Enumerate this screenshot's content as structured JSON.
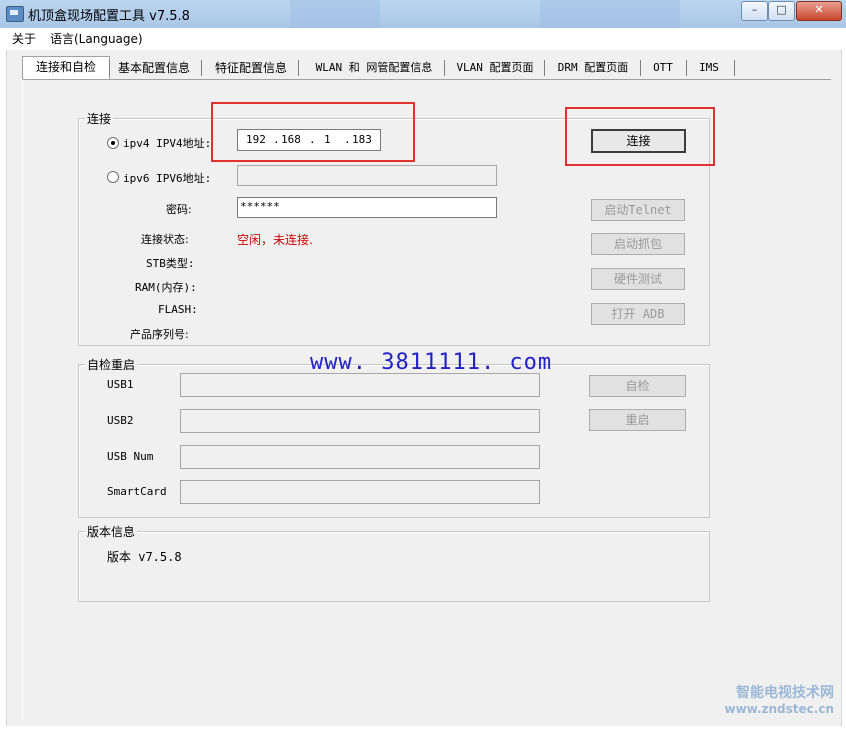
{
  "window": {
    "title": "机顶盒现场配置工具 v7.5.8",
    "minimize": "–",
    "maximize": "□",
    "close": "✕"
  },
  "menu": {
    "about": "关于",
    "language": "语言(Language)"
  },
  "tabs": [
    {
      "label": "连接和自检",
      "active": true
    },
    {
      "label": "基本配置信息"
    },
    {
      "label": "特征配置信息"
    },
    {
      "label": "WLAN 和 网管配置信息"
    },
    {
      "label": "VLAN 配置页面"
    },
    {
      "label": "DRM 配置页面"
    },
    {
      "label": "OTT"
    },
    {
      "label": "IMS"
    }
  ],
  "connection": {
    "group_title": "连接",
    "ipv4_label": "ipv4 IPV4地址:",
    "ipv4_selected": true,
    "ipv4_octets": [
      "192",
      "168",
      "1",
      "183"
    ],
    "ipv4_dot": ".",
    "ipv6_label": "ipv6 IPV6地址:",
    "password_label": "密码:",
    "password_value": "******",
    "status_label": "连接状态:",
    "status_value": "空闲，未连接.",
    "stb_label": "STB类型:",
    "ram_label": "RAM(内存):",
    "flash_label": "FLASH:",
    "serial_label": "产品序列号:",
    "connect_button": "连接",
    "telnet_button": "启动Telnet",
    "capture_button": "启动抓包",
    "hwtest_button": "硬件测试",
    "adb_button": "打开 ADB"
  },
  "selfcheck": {
    "group_title": "自检重启",
    "usb1_label": "USB1",
    "usb2_label": "USB2",
    "usbnum_label": "USB Num",
    "smartcard_label": "SmartCard",
    "selfcheck_button": "自检",
    "restart_button": "重启"
  },
  "version": {
    "group_title": "版本信息",
    "text": "版本 v7.5.8"
  },
  "watermark": "www. 3811111. com",
  "corner_brand": {
    "name": "智能电视技术网",
    "url": "www.zndstec.cn"
  },
  "colors": {
    "status_red": "#d40000",
    "highlight_red": "#e03030",
    "watermark_blue": "#2121c8"
  }
}
